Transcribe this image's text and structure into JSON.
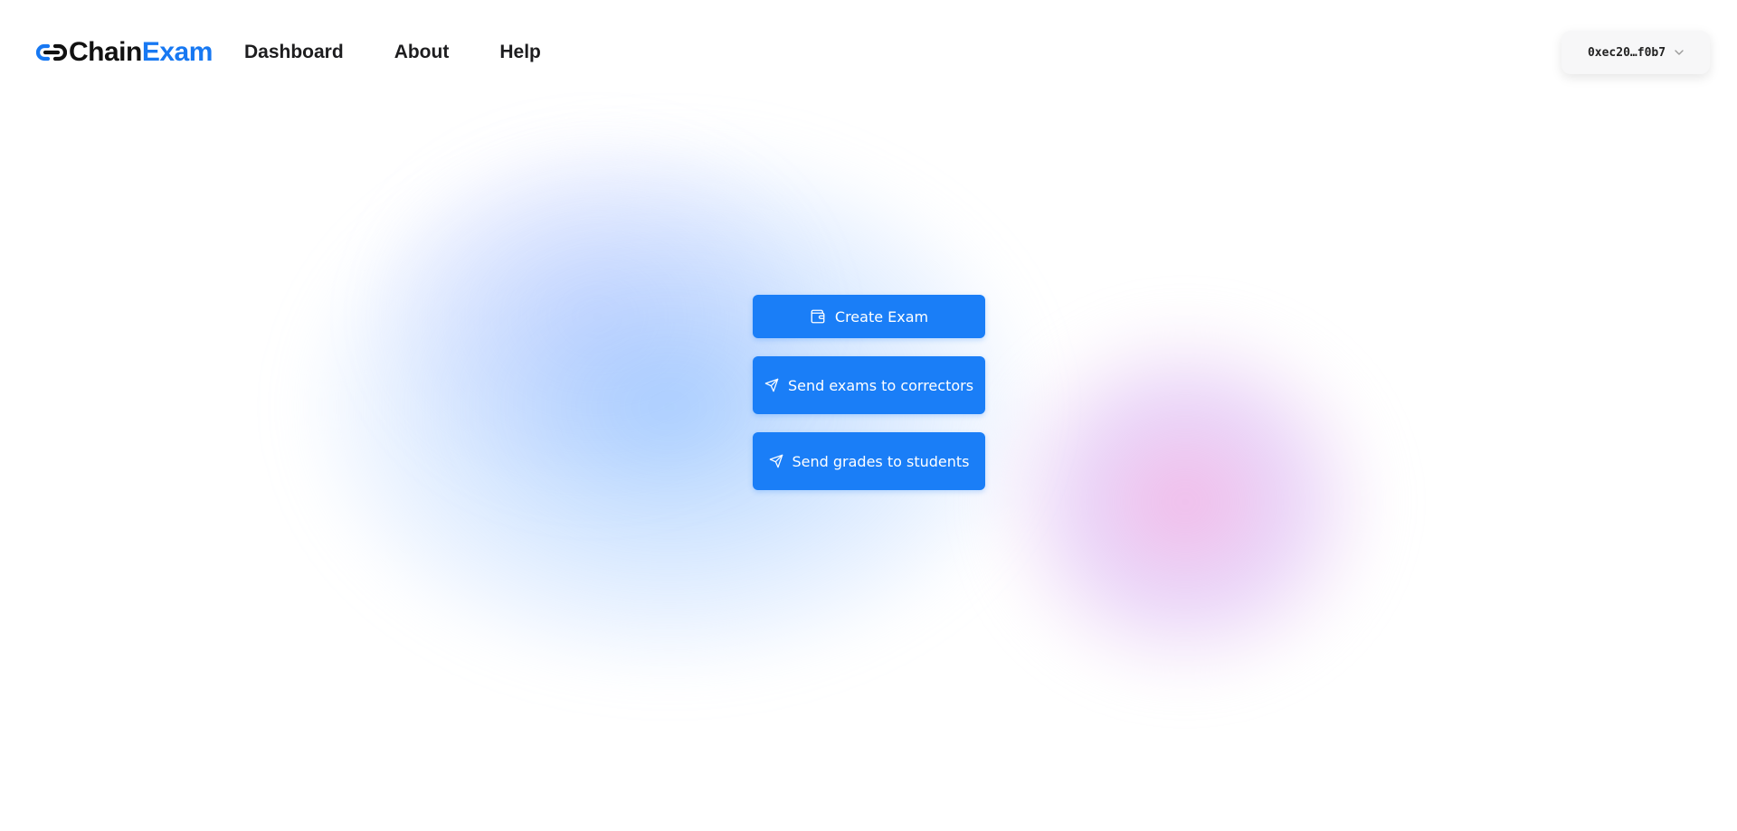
{
  "brand": {
    "part1": "Chain",
    "part2": "Exam",
    "icon": "chain-link-icon"
  },
  "nav": {
    "items": [
      {
        "label": "Dashboard"
      },
      {
        "label": "About"
      },
      {
        "label": "Help"
      }
    ]
  },
  "account": {
    "address": "0xec20…f0b7",
    "icon": "chevron-down-icon"
  },
  "actions": {
    "create_exam": {
      "label": "Create Exam",
      "icon": "wallet-icon"
    },
    "send_correctors": {
      "label": "Send exams to correctors",
      "icon": "send-icon"
    },
    "send_grades": {
      "label": "Send grades to students",
      "icon": "send-icon"
    }
  },
  "colors": {
    "accent": "#1a7ef7",
    "brand_blue": "#1778f2",
    "text_dark": "#1d1d1f",
    "blob_blue": "#8cc0ff",
    "blob_pink": "#eba0e1"
  }
}
